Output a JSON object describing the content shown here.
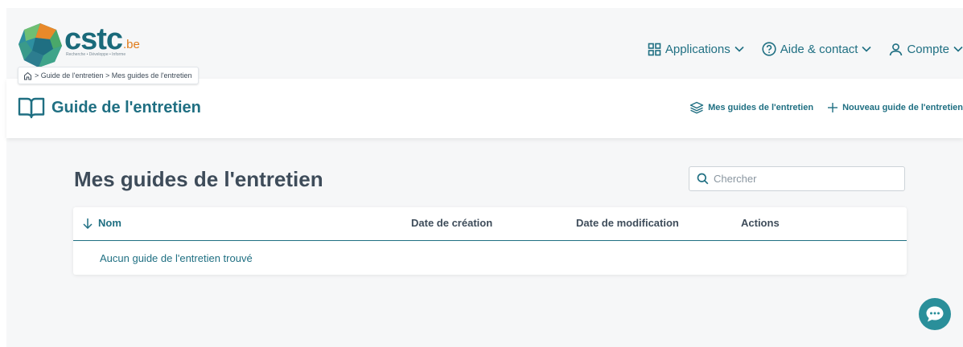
{
  "logo": {
    "name": "cstc",
    "suffix": ".be",
    "tagline": "Recherche • Développe • Informe"
  },
  "nav": {
    "applications": "Applications",
    "help": "Aide & contact",
    "account": "Compte"
  },
  "breadcrumb": "> Guide de l'entretien > Mes guides de l'entretien",
  "section": {
    "title": "Guide de l'entretien",
    "my_guides": "Mes guides de l'entretien",
    "new_guide": "Nouveau guide de l'entretien"
  },
  "main": {
    "title": "Mes guides de l'entretien",
    "search_placeholder": "Chercher"
  },
  "table": {
    "columns": [
      "Nom",
      "Date de création",
      "Date de modification",
      "Actions"
    ],
    "empty_message": "Aucun guide de l'entretien trouvé"
  },
  "colors": {
    "primary": "#1f6f82",
    "chat": "#2a8f9a",
    "logo_accent": "#e07b1a"
  }
}
